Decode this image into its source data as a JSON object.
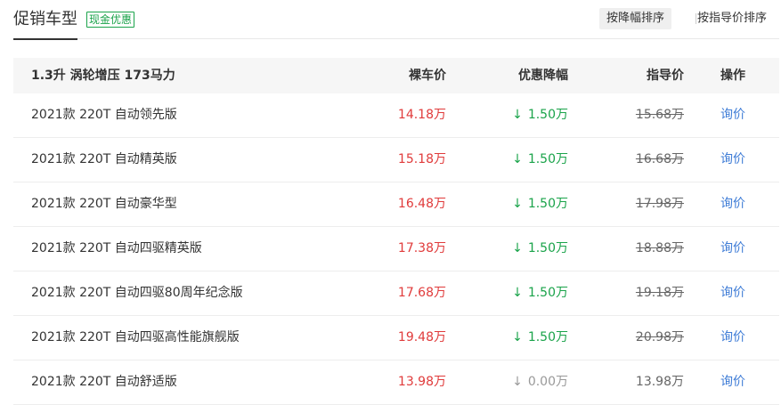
{
  "header": {
    "title": "促销车型",
    "badge": "现金优惠",
    "sort_options": [
      "按降幅排序",
      "按指导价排序"
    ]
  },
  "table": {
    "columns": [
      "1.3升 涡轮增压 173马力",
      "裸车价",
      "优惠降幅",
      "指导价",
      "操作"
    ],
    "rows": [
      {
        "name": "2021款 220T 自动领先版",
        "price": "14.18万",
        "discount": "1.50万",
        "guide": "15.68万",
        "action": "询价"
      },
      {
        "name": "2021款 220T 自动精英版",
        "price": "15.18万",
        "discount": "1.50万",
        "guide": "16.68万",
        "action": "询价"
      },
      {
        "name": "2021款 220T 自动豪华型",
        "price": "16.48万",
        "discount": "1.50万",
        "guide": "17.98万",
        "action": "询价"
      },
      {
        "name": "2021款 220T 自动四驱精英版",
        "price": "17.38万",
        "discount": "1.50万",
        "guide": "18.88万",
        "action": "询价"
      },
      {
        "name": "2021款 220T 自动四驱80周年纪念版",
        "price": "17.68万",
        "discount": "1.50万",
        "guide": "19.18万",
        "action": "询价"
      },
      {
        "name": "2021款 220T 自动四驱高性能旗舰版",
        "price": "19.48万",
        "discount": "1.50万",
        "guide": "20.98万",
        "action": "询价"
      },
      {
        "name": "2021款 220T 自动舒适版",
        "price": "13.98万",
        "discount": "0.00万",
        "guide": "13.98万",
        "action": "询价"
      }
    ]
  },
  "colors": {
    "price": "#e03b3b",
    "discount": "#1aa34a",
    "link": "#3d7bd6"
  },
  "icons": {
    "discount_arrow": "arrow-down-icon"
  }
}
